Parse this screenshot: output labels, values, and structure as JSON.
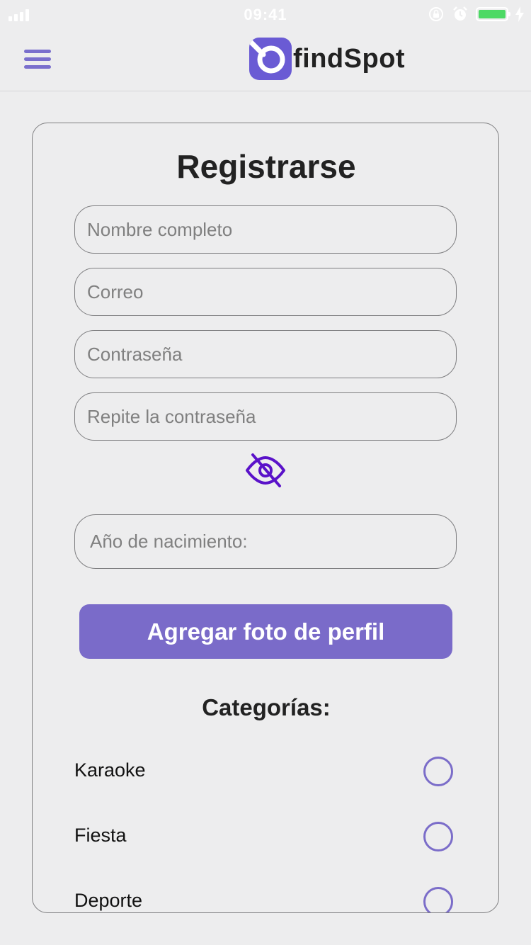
{
  "status_bar": {
    "time": "09:41",
    "icons": [
      "signal-icon",
      "rotation-lock-icon",
      "alarm-icon",
      "battery-icon",
      "charging-icon"
    ]
  },
  "header": {
    "menu_icon": "hamburger-menu-icon",
    "logo_text": "findSpot",
    "brand_color": "#6a5bd4"
  },
  "form": {
    "title": "Registrarse",
    "fields": {
      "full_name_placeholder": "Nombre completo",
      "email_placeholder": "Correo",
      "password_placeholder": "Contraseña",
      "repeat_password_placeholder": "Repite la contraseña",
      "birth_year_placeholder": "Año de nacimiento:"
    },
    "toggle_visibility_icon": "eye-slash-icon",
    "photo_button_label": "Agregar foto de perfil",
    "categories_title": "Categorías:",
    "categories": [
      {
        "label": "Karaoke",
        "selected": false
      },
      {
        "label": "Fiesta",
        "selected": false
      },
      {
        "label": "Deporte",
        "selected": false
      }
    ]
  },
  "colors": {
    "accent": "#7a6bc9",
    "eye_icon": "#5a12c9",
    "background": "#ededee"
  }
}
